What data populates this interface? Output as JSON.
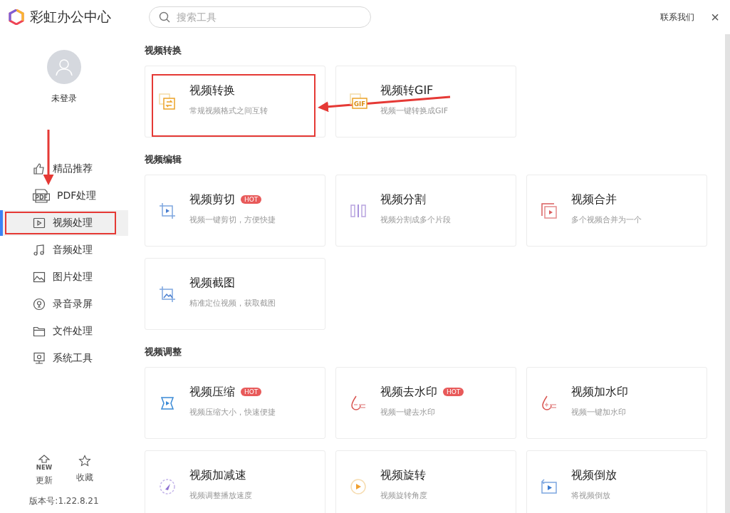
{
  "app": {
    "title": "彩虹办公中心"
  },
  "search": {
    "placeholder": "搜索工具"
  },
  "header": {
    "contact": "联系我们",
    "close": "×"
  },
  "user": {
    "name": "未登录"
  },
  "sidebar": {
    "items": [
      {
        "label": "精品推荐",
        "kind": "thumb",
        "selected": false,
        "highlighted": false
      },
      {
        "label": "PDF处理",
        "kind": "pdf",
        "icon_label": "PDF",
        "selected": false,
        "highlighted": false
      },
      {
        "label": "视频处理",
        "kind": "video",
        "selected": true,
        "highlighted": true
      },
      {
        "label": "音频处理",
        "kind": "music",
        "selected": false,
        "highlighted": false
      },
      {
        "label": "图片处理",
        "kind": "image",
        "selected": false,
        "highlighted": false
      },
      {
        "label": "录音录屏",
        "kind": "mic",
        "selected": false,
        "highlighted": false
      },
      {
        "label": "文件处理",
        "kind": "folder",
        "selected": false,
        "highlighted": false
      },
      {
        "label": "系统工具",
        "kind": "system",
        "selected": false,
        "highlighted": false
      }
    ]
  },
  "footer": {
    "actions": [
      {
        "label": "更新",
        "kind": "new",
        "icon_label": "NEW"
      },
      {
        "label": "收藏",
        "kind": "star"
      }
    ],
    "version": "版本号:1.22.8.21"
  },
  "sections": [
    {
      "title": "视频转换",
      "tools": [
        {
          "name": "视频转换",
          "desc": "常规视频格式之间互转",
          "kind": "convert",
          "hot": false,
          "highlighted": true
        },
        {
          "name": "视频转GIF",
          "desc": "视频一键转换成GIF",
          "kind": "gif",
          "icon_label": "GIF",
          "hot": false,
          "highlighted": false
        }
      ]
    },
    {
      "title": "视频编辑",
      "tools": [
        {
          "name": "视频剪切",
          "desc": "视频一键剪切，方便快捷",
          "kind": "cut",
          "hot": true,
          "badge": "HOT",
          "highlighted": false
        },
        {
          "name": "视频分割",
          "desc": "视频分割成多个片段",
          "kind": "split",
          "hot": false,
          "highlighted": false
        },
        {
          "name": "视频合并",
          "desc": "多个视频合并为一个",
          "kind": "merge",
          "hot": false,
          "highlighted": false
        },
        {
          "name": "视频截图",
          "desc": "精准定位视频，获取截图",
          "kind": "screenshot",
          "hot": false,
          "highlighted": false
        }
      ]
    },
    {
      "title": "视频调整",
      "tools": [
        {
          "name": "视频压缩",
          "desc": "视频压缩大小，快速便捷",
          "kind": "compress",
          "hot": true,
          "badge": "HOT",
          "highlighted": false
        },
        {
          "name": "视频去水印",
          "desc": "视频一键去水印",
          "kind": "unmark",
          "hot": true,
          "badge": "HOT",
          "highlighted": false
        },
        {
          "name": "视频加水印",
          "desc": "视频一键加水印",
          "kind": "addmark",
          "hot": false,
          "highlighted": false
        },
        {
          "name": "视频加减速",
          "desc": "视频调整播放速度",
          "kind": "speed",
          "hot": false,
          "highlighted": false
        },
        {
          "name": "视频旋转",
          "desc": "视频旋转角度",
          "kind": "rotate",
          "hot": false,
          "highlighted": false
        },
        {
          "name": "视频倒放",
          "desc": "将视频倒放",
          "kind": "reverse",
          "hot": false,
          "highlighted": false
        }
      ]
    }
  ]
}
